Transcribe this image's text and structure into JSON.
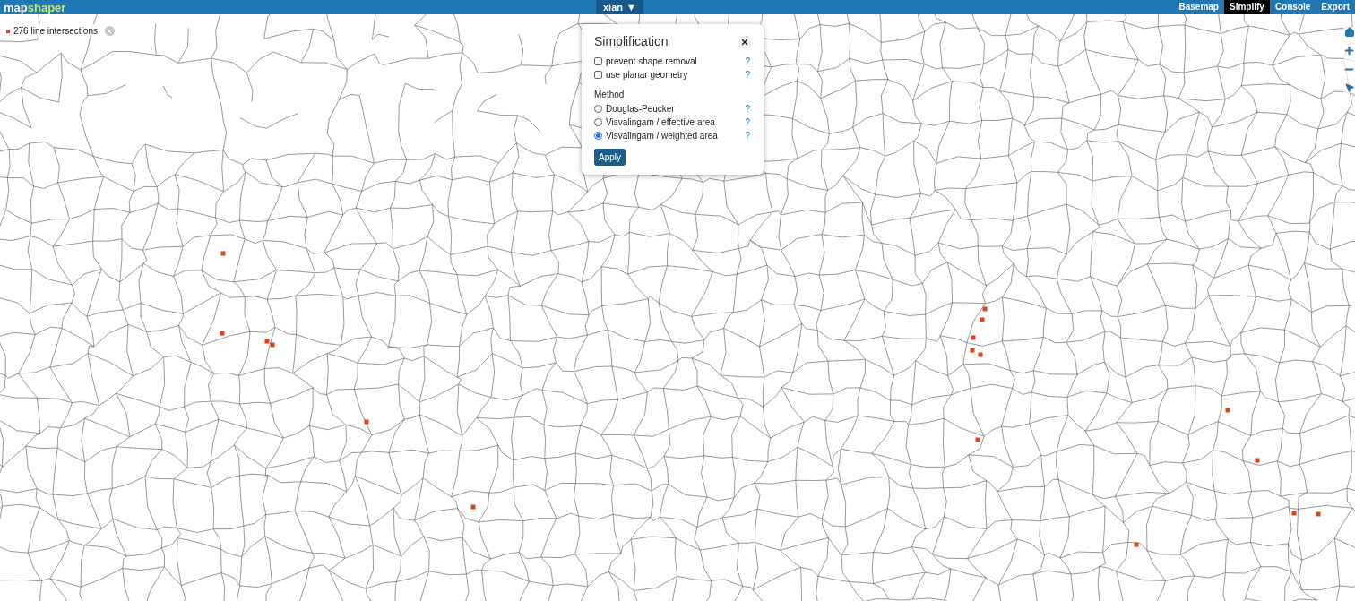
{
  "header": {
    "logo": {
      "part_1": "map",
      "part_2": "shaper"
    },
    "layer_menu": {
      "label": "xian",
      "caret": "▼"
    },
    "tabs": [
      {
        "label": "Basemap",
        "selected": false
      },
      {
        "label": "Simplify",
        "selected": true
      },
      {
        "label": "Console",
        "selected": false
      },
      {
        "label": "Export",
        "selected": false
      }
    ]
  },
  "intersections": {
    "label": "276 line intersections"
  },
  "simplification": {
    "title": "Simplification",
    "options": [
      {
        "kind": "checkbox",
        "label": "prevent shape removal",
        "checked": false,
        "help": "?"
      },
      {
        "kind": "checkbox",
        "label": "use planar geometry",
        "checked": false,
        "help": "?"
      }
    ],
    "method_label": "Method",
    "methods": [
      {
        "label": "Douglas-Peucker",
        "selected": false,
        "help": "?"
      },
      {
        "label": "Visvalingam / effective area",
        "selected": false,
        "help": "?"
      },
      {
        "label": "Visvalingam / weighted area",
        "selected": true,
        "help": "?"
      }
    ],
    "apply": "Apply"
  }
}
